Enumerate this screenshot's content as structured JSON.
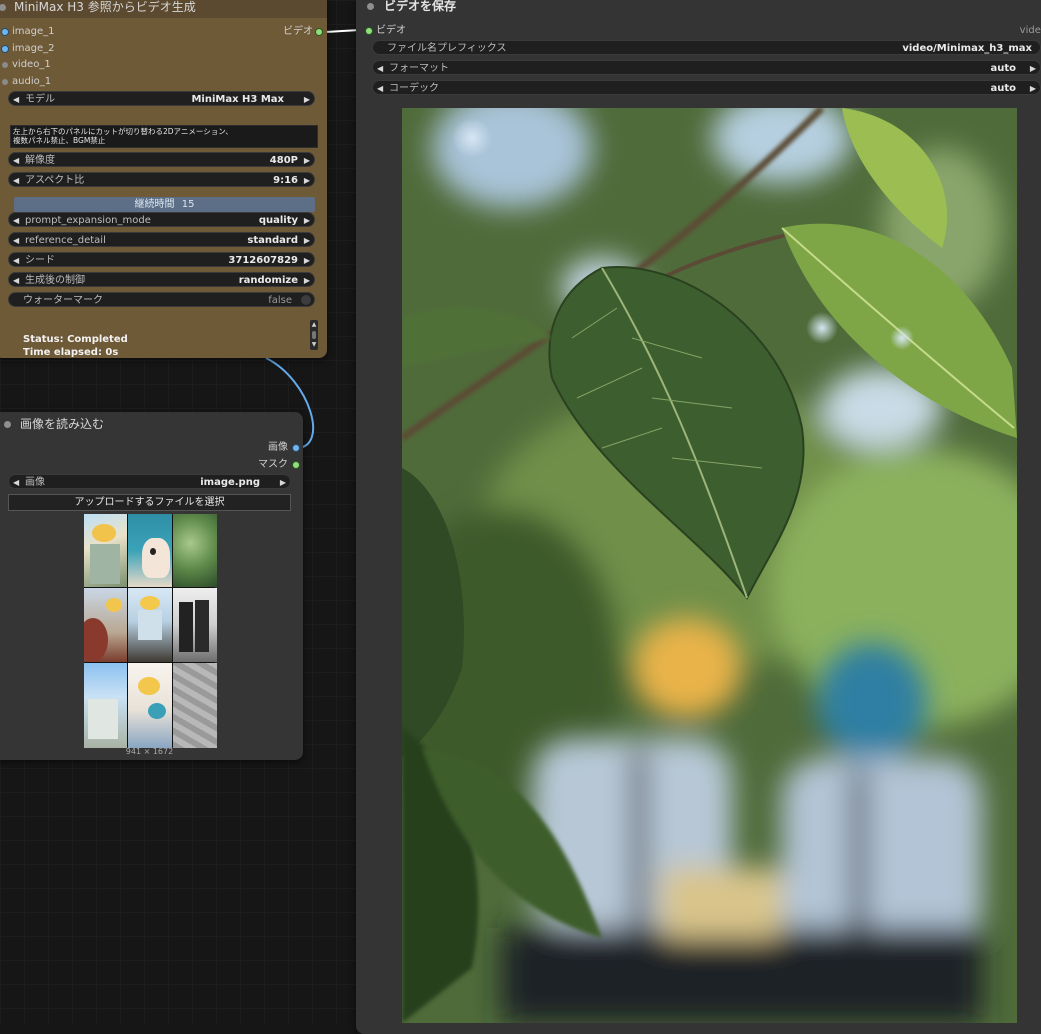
{
  "minimax_node": {
    "title": "MiniMax H3 参照からビデオ生成",
    "inputs": [
      "image_1",
      "image_2",
      "video_1",
      "audio_1"
    ],
    "output": "ビデオ",
    "model": {
      "label": "モデル",
      "value": "MiniMax H3 Max"
    },
    "prompt": "左上から右下のパネルにカットが切り替わる2Dアニメーション、\n複数パネル禁止、BGM禁止",
    "resolution": {
      "label": "解像度",
      "value": "480P"
    },
    "aspect": {
      "label": "アスペクト比",
      "value": "9:16"
    },
    "duration": {
      "label": "継続時間",
      "value": "15"
    },
    "expansion": {
      "label": "prompt_expansion_mode",
      "value": "quality"
    },
    "reference_detail": {
      "label": "reference_detail",
      "value": "standard"
    },
    "seed": {
      "label": "シード",
      "value": "3712607829"
    },
    "control_after": {
      "label": "生成後の制御",
      "value": "randomize"
    },
    "watermark": {
      "label": "ウォーターマーク",
      "value": "false"
    },
    "status": "Status: Completed",
    "elapsed": "Time elapsed: 0s"
  },
  "load_node": {
    "title": "画像を読み込む",
    "outputs": [
      "画像",
      "マスク"
    ],
    "image": {
      "label": "画像",
      "value": "image.png"
    },
    "upload_label": "アップロードするファイルを選択",
    "dimensions": "941 × 1672"
  },
  "save_node": {
    "title": "ビデオを保存",
    "input": "ビデオ",
    "output": "video",
    "prefix": {
      "label": "ファイル名プレフィックス",
      "value": "video/Minimax_h3_max"
    },
    "format": {
      "label": "フォーマット",
      "value": "auto"
    },
    "codec": {
      "label": "コーデック",
      "value": "auto"
    }
  },
  "icons": {
    "left_arrow": "◀",
    "right_arrow": "▶",
    "scroll_up": "▲",
    "scroll_down": "▼"
  },
  "colors": {
    "minimax_body": "#6f5a38",
    "minimax_title": "#5b4a2f",
    "duration_bar": "#5d6f86",
    "video_port": "#8fe07a",
    "image_port": "#6fb5f0",
    "node_body": "#353535"
  }
}
